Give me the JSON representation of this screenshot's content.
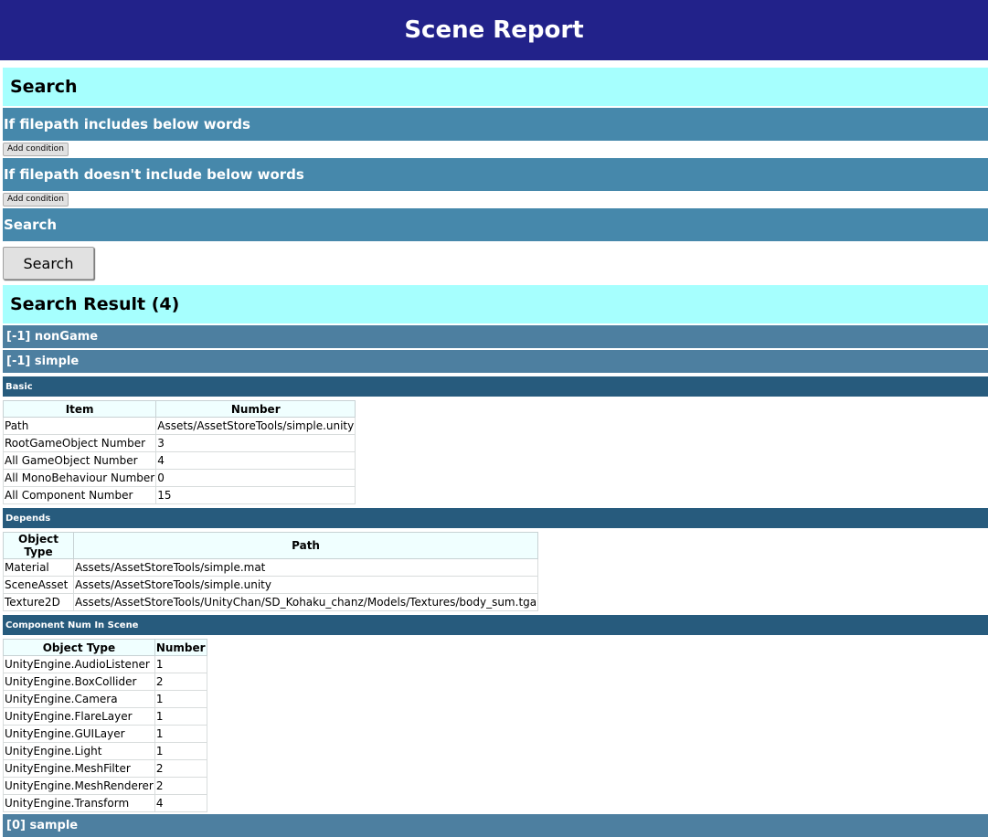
{
  "header": {
    "title": "Scene Report"
  },
  "search": {
    "title": "Search",
    "include_label": "If filepath includes below words",
    "include_add_button": "Add condition",
    "exclude_label": "If filepath doesn't include below words",
    "exclude_add_button": "Add condition",
    "search_bar_label": "Search",
    "search_button": "Search"
  },
  "results": {
    "title": "Search Result (4)",
    "scenes": [
      {
        "label": "[-1] nonGame"
      },
      {
        "label": "[-1] simple"
      },
      {
        "label": "[0] sample"
      }
    ],
    "basic": {
      "title": "Basic",
      "headers": [
        "Item",
        "Number"
      ],
      "rows": [
        [
          "Path",
          "Assets/AssetStoreTools/simple.unity"
        ],
        [
          "RootGameObject Number",
          "3"
        ],
        [
          "All GameObject Number",
          "4"
        ],
        [
          "All MonoBehaviour Number",
          "0"
        ],
        [
          "All Component Number",
          "15"
        ]
      ]
    },
    "depends": {
      "title": "Depends",
      "headers": [
        "Object Type",
        "Path"
      ],
      "rows": [
        [
          "Material",
          "Assets/AssetStoreTools/simple.mat"
        ],
        [
          "SceneAsset",
          "Assets/AssetStoreTools/simple.unity"
        ],
        [
          "Texture2D",
          "Assets/AssetStoreTools/UnityChan/SD_Kohaku_chanz/Models/Textures/body_sum.tga"
        ]
      ]
    },
    "components": {
      "title": "Component Num In Scene",
      "headers": [
        "Object Type",
        "Number"
      ],
      "rows": [
        [
          "UnityEngine.AudioListener",
          "1"
        ],
        [
          "UnityEngine.BoxCollider",
          "2"
        ],
        [
          "UnityEngine.Camera",
          "1"
        ],
        [
          "UnityEngine.FlareLayer",
          "1"
        ],
        [
          "UnityEngine.GUILayer",
          "1"
        ],
        [
          "UnityEngine.Light",
          "1"
        ],
        [
          "UnityEngine.MeshFilter",
          "2"
        ],
        [
          "UnityEngine.MeshRenderer",
          "2"
        ],
        [
          "UnityEngine.Transform",
          "4"
        ]
      ]
    }
  },
  "colors": {
    "header_bg": "#22228a",
    "section_title_bg": "#a6fffe",
    "teal_bar_bg": "#4688ab",
    "scene_bar_bg": "#4d7fa0",
    "sub_bar_bg": "#275b7d",
    "table_header_bg": "#f0ffff"
  }
}
